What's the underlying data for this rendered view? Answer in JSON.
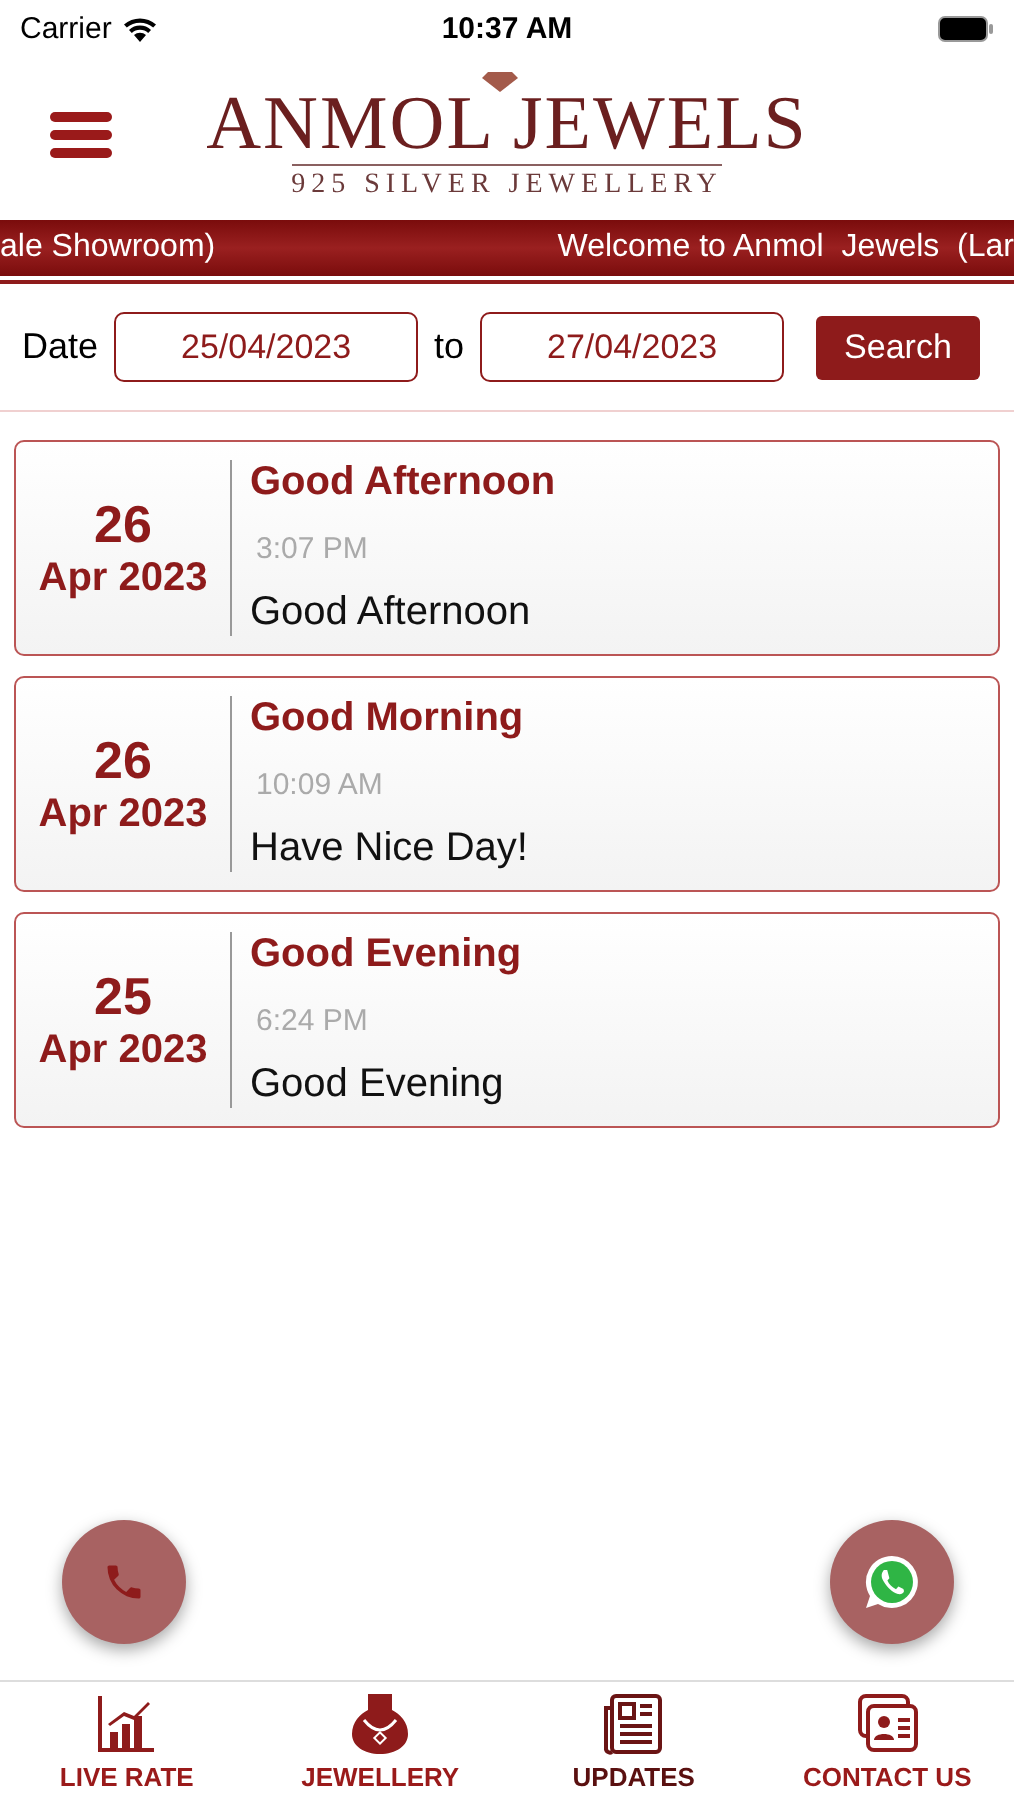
{
  "status_bar": {
    "carrier": "Carrier",
    "time": "10:37 AM"
  },
  "header": {
    "logo_title": "ANMOL JEWELS",
    "logo_subtitle": "925 SILVER JEWELLERY"
  },
  "marquee": [
    "ale Showroom)",
    "Welcome to Anmol  Jewels  (Lar"
  ],
  "filter": {
    "label": "Date",
    "from": "25/04/2023",
    "separator": "to",
    "to": "27/04/2023",
    "button": "Search"
  },
  "messages": [
    {
      "day": "26",
      "month_year": "Apr 2023",
      "title": "Good Afternoon",
      "time": "3:07 PM",
      "body": "Good Afternoon"
    },
    {
      "day": "26",
      "month_year": "Apr 2023",
      "title": "Good Morning",
      "time": "10:09 AM",
      "body": "Have Nice Day!"
    },
    {
      "day": "25",
      "month_year": "Apr 2023",
      "title": "Good Evening",
      "time": "6:24 PM",
      "body": "Good Evening"
    }
  ],
  "tabs": [
    {
      "kind": "chart",
      "label": "LIVE RATE",
      "selected": false
    },
    {
      "kind": "necklace",
      "label": "JEWELLERY",
      "selected": false
    },
    {
      "kind": "news",
      "label": "UPDATES",
      "selected": true
    },
    {
      "kind": "contact",
      "label": "CONTACT US",
      "selected": false
    }
  ]
}
